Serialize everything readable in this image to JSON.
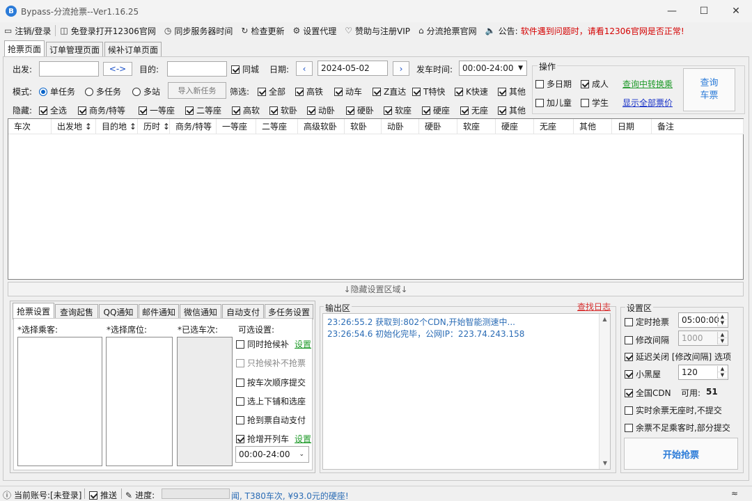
{
  "window": {
    "title": "Bypass-分流抢票--Ver1.16.25"
  },
  "menu": {
    "logout": "注销/登录",
    "open_12306": "免登录打开12306官网",
    "sync_time": "同步服务器时间",
    "check_update": "检查更新",
    "proxy": "设置代理",
    "donate": "赞助与注册VIP",
    "official": "分流抢票官网",
    "notice_label": "公告:",
    "notice_text": "软件遇到问题时，请看12306官网是否正常!"
  },
  "tabs": [
    "抢票页面",
    "订单管理页面",
    "候补订单页面"
  ],
  "query": {
    "from_label": "出发:",
    "swap": "<->",
    "to_label": "目的:",
    "same_city": "同城",
    "date_label": "日期:",
    "date": "2024-05-02",
    "depart_label": "发车时间:",
    "depart_value": "00:00-24:00"
  },
  "mode": {
    "label": "模式:",
    "single": "单任务",
    "multi": "多任务",
    "multi_station": "多站",
    "import": "导入新任务"
  },
  "filter": {
    "label": "筛选:",
    "items": [
      "全部",
      "高铁",
      "动车",
      "Z直达",
      "T特快",
      "K快速",
      "其他"
    ]
  },
  "hide": {
    "label": "隐藏:",
    "items": [
      "全选",
      "商务/特等",
      "一等座",
      "二等座",
      "高软",
      "软卧",
      "动卧",
      "硬卧",
      "软座",
      "硬座",
      "无座",
      "其他"
    ]
  },
  "ops": {
    "title": "操作",
    "multi_date": "多日期",
    "adult": "成人",
    "transfer": "查询中转换乘",
    "add_child": "加儿童",
    "student": "学生",
    "show_all": "显示全部票价",
    "query_button": "查询\n车票"
  },
  "grid": {
    "columns": [
      "车次",
      "出发地 ↕",
      "目的地 ↕",
      "历时 ↕",
      "商务/特等",
      "一等座",
      "二等座",
      "高级软卧",
      "软卧",
      "动卧",
      "硬卧",
      "软座",
      "硬座",
      "无座",
      "其他",
      "日期",
      "备注"
    ]
  },
  "collapse_bar": "↓隐藏设置区域↓",
  "bottom_tabs": [
    "抢票设置",
    "查询起售",
    "QQ通知",
    "邮件通知",
    "微信通知",
    "自动支付",
    "多任务设置"
  ],
  "booking": {
    "passenger": "*选择乘客:",
    "seat": "*选择席位:",
    "selected_train": "*已选车次:",
    "options_title": "可选设置:",
    "opt_both": "同时抢候补",
    "opt_both_link": "设置",
    "opt_only_wait": "只抢候补不抢票",
    "opt_order": "按车次顺序提交",
    "opt_berth": "选上下铺和选座",
    "opt_autopay": "抢到票自动支付",
    "opt_extra": "抢增开列车",
    "opt_extra_link": "设置",
    "time_range": "00:00-24:00"
  },
  "output": {
    "title": "输出区",
    "find_log": "查找日志",
    "lines": [
      "23:26:55.2   获取到:802个CDN,开始智能测速中...",
      "23:26:54.6   初始化完毕，公网IP：223.74.243.158"
    ]
  },
  "settings": {
    "title": "设置区",
    "timed": "定时抢票",
    "timed_value": "05:00:00",
    "interval": "修改间隔",
    "interval_value": "1000",
    "delay_close": "延迟关闭 [修改间隔] 选项",
    "blackroom": "小黑屋",
    "blackroom_value": "120",
    "cdn": "全国CDN",
    "cdn_available_label": "可用:",
    "cdn_available": "51",
    "no_standing": "实时余票无座时,不提交",
    "partial": "余票不足乘客时,部分提交",
    "start_button": "开始抢票"
  },
  "status": {
    "account": "当前账号:[未登录]",
    "push": "推送",
    "progress_label": "进度:",
    "scroll_text": "闻, T380车次, ¥93.0元的硬座!"
  },
  "colors": {
    "accent": "#0a64c8",
    "notice": "#d40000",
    "log": "#2b6cb5"
  }
}
